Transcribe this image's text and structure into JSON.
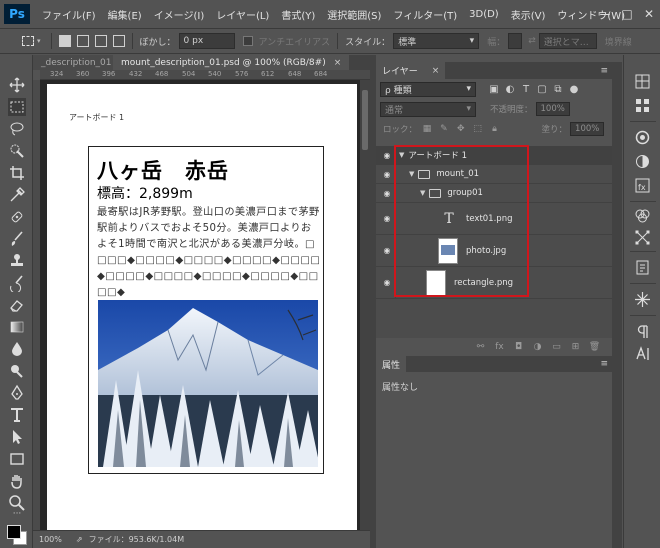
{
  "app": {
    "logo": "Ps"
  },
  "menu": [
    "ファイル(F)",
    "編集(E)",
    "イメージ(I)",
    "レイヤー(L)",
    "書式(Y)",
    "選択範囲(S)",
    "フィルター(T)",
    "3D(D)",
    "表示(V)",
    "ウィンドウ(W)"
  ],
  "window_controls": {
    "minimize": "ー",
    "maximize": "□",
    "close": "✕"
  },
  "options": {
    "feather_label": "ぼかし：",
    "feather_value": "0 px",
    "antialias_label": "アンチエイリアス",
    "style_label": "スタイル：",
    "style_value": "標準",
    "width_label": "幅：",
    "refine_label": "選択とマ…",
    "border_label": "境界線"
  },
  "document": {
    "tab_inactive": "_description_01",
    "tab_active": "mount_description_01.psd @ 100% (RGB/8#)",
    "tab_close": "×",
    "ruler_ticks": [
      "324",
      "360",
      "396",
      "432",
      "468",
      "504",
      "540",
      "576",
      "612",
      "648",
      "684"
    ],
    "artboard_label": "アートボード 1"
  },
  "card": {
    "title": "八ヶ岳　赤岳",
    "elevation": "標高：2,899m",
    "body": "最寄駅はJR茅野駅。登山口の美濃戸口まで茅野駅前よりバスでおよそ50分。美濃戸口よりおよそ1時間で南沢と北沢がある美濃戸分岐。□□□□◆□□□□◆□□□□◆□□□□◆□□□□◆□□□□◆□□□□◆□□□□◆□□□□◆□□□□◆"
  },
  "status": {
    "zoom": "100%",
    "file_info": "ファイル：953.6K/1.04M"
  },
  "layers_panel": {
    "tab": "レイヤー",
    "tab_close": "×",
    "menu": "≡",
    "filter_kind": "ρ 種類",
    "blend_mode": "通常",
    "opacity_label": "不透明度：",
    "opacity_value": "100%",
    "lock_label": "ロック：",
    "fill_label": "塗り：",
    "fill_value": "100%",
    "layers": [
      {
        "name": "アートボード 1",
        "type": "artboard"
      },
      {
        "name": "mount_01",
        "type": "group"
      },
      {
        "name": "group01",
        "type": "group"
      },
      {
        "name": "text01.png",
        "type": "text"
      },
      {
        "name": "photo.jpg",
        "type": "image"
      },
      {
        "name": "rectangle.png",
        "type": "image"
      }
    ],
    "highlight_color": "#d0161c"
  },
  "properties_panel": {
    "tab": "属性",
    "menu": "≡",
    "empty_text": "属性なし"
  },
  "colors": {
    "foreground": "#000000",
    "background": "#ffffff",
    "ui_bg": "#535353"
  }
}
